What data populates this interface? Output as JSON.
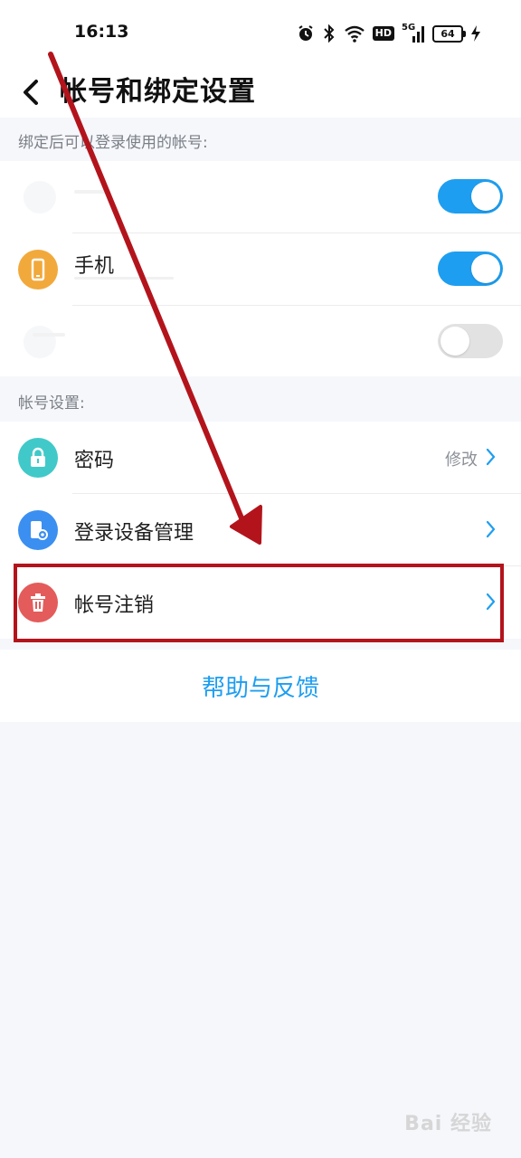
{
  "status_bar": {
    "time": "16:13",
    "hd": "HD",
    "signal": "5G",
    "battery": "64",
    "icons": [
      "alarm-icon",
      "bluetooth-icon",
      "wifi-icon",
      "hd-icon",
      "signal-icon",
      "battery-icon",
      "charging-icon"
    ]
  },
  "header": {
    "title": "帐号和绑定设置",
    "back_icon": "back-chevron-icon"
  },
  "bind_section": {
    "label": "绑定后可以登录使用的帐号:",
    "items": [
      {
        "label": "",
        "toggle": "on",
        "icon": "qq-icon"
      },
      {
        "label": "手机",
        "toggle": "on",
        "icon": "phone-icon",
        "icon_color": "#f2a93b"
      },
      {
        "label": "",
        "toggle": "off",
        "icon": "wechat-icon"
      }
    ]
  },
  "account_section": {
    "label": "帐号设置:",
    "items": [
      {
        "label": "密码",
        "right_text": "修改",
        "icon": "lock-icon",
        "icon_color": "#41c9c9"
      },
      {
        "label": "登录设备管理",
        "icon": "device-settings-icon",
        "icon_color": "#3b8ff0"
      },
      {
        "label": "帐号注销",
        "icon": "trash-icon",
        "icon_color": "#e45b5b"
      }
    ]
  },
  "help": {
    "label": "帮助与反馈"
  },
  "watermark": {
    "text": "Bai 经验"
  },
  "colors": {
    "accent": "#1e9ef0",
    "annotation": "#b3141c",
    "background": "#f5f7fb"
  }
}
